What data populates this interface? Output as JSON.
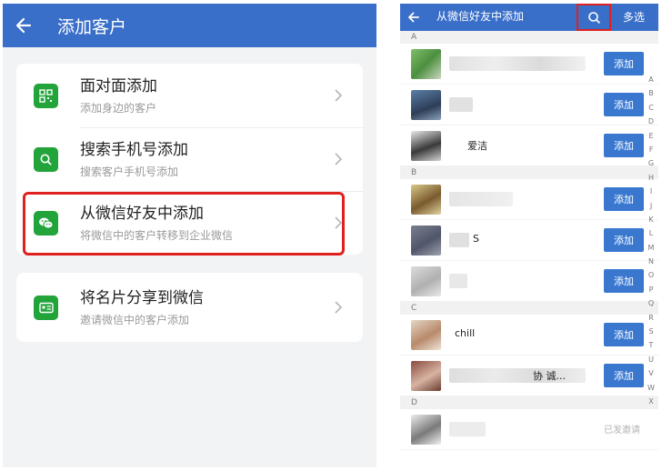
{
  "left": {
    "title": "添加客户",
    "options": [
      {
        "title": "面对面添加",
        "subtitle": "添加身边的客户",
        "icon": "qrcode-icon"
      },
      {
        "title": "搜索手机号添加",
        "subtitle": "搜索客户手机号添加",
        "icon": "search-icon"
      },
      {
        "title": "从微信好友中添加",
        "subtitle": "将微信中的客户转移到企业微信",
        "icon": "wechat-icon"
      }
    ],
    "share": {
      "title": "将名片分享到微信",
      "subtitle": "邀请微信中的客户添加",
      "icon": "card-icon"
    },
    "accent": "#3a6fc9",
    "highlight": "#e0201f",
    "icon_green": "#22a43b"
  },
  "right": {
    "title": "从微信好友中添加",
    "multi_select": "多选",
    "add_label": "添加",
    "invited_label": "已发邀请",
    "sections": [
      {
        "letter": "A",
        "contacts": [
          {
            "name": "",
            "state": "add"
          },
          {
            "name": "",
            "state": "add"
          },
          {
            "name": "爱洁",
            "state": "add"
          }
        ]
      },
      {
        "letter": "B",
        "contacts": [
          {
            "name": "",
            "state": "add"
          },
          {
            "name": "S",
            "state": "add"
          },
          {
            "name": "",
            "state": "add"
          }
        ]
      },
      {
        "letter": "C",
        "contacts": [
          {
            "name": "chill",
            "state": "add"
          },
          {
            "name": "协      诚...",
            "state": "add"
          }
        ]
      },
      {
        "letter": "D",
        "contacts": [
          {
            "name": "",
            "state": "invited"
          }
        ]
      }
    ],
    "index": [
      "A",
      "B",
      "C",
      "D",
      "E",
      "F",
      "G",
      "H",
      "I",
      "J",
      "K",
      "L",
      "M",
      "N",
      "O",
      "P",
      "Q",
      "R",
      "S",
      "T",
      "U",
      "V",
      "W",
      "X"
    ]
  }
}
